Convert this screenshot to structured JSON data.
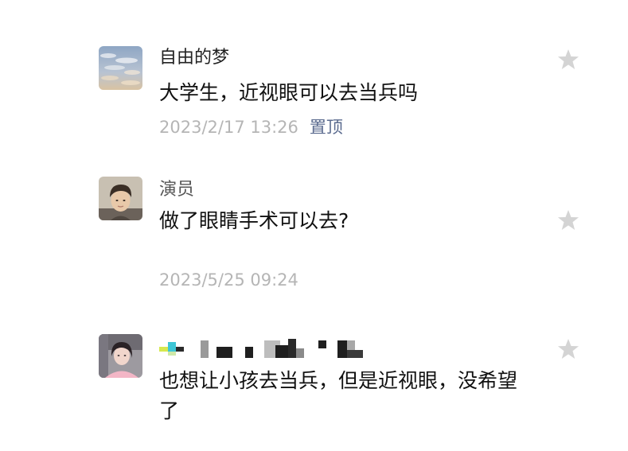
{
  "comments": [
    {
      "username": "自由的梦",
      "text": "大学生，近视眼可以去当兵吗",
      "timestamp": "2023/2/17 13:26",
      "pin_label": "置顶",
      "star_icon": "star-icon"
    },
    {
      "username": "演员",
      "text": "做了眼睛手术可以去?",
      "timestamp": "2023/5/25 09:24",
      "star_icon": "star-icon"
    },
    {
      "username_pixelated": true,
      "text": "也想让小孩去当兵，但是近视眼，没希望了",
      "star_icon": "star-icon"
    }
  ],
  "colors": {
    "timestamp": "#b5b5b5",
    "pin": "#5b6b8f",
    "star": "#d4d4d4"
  }
}
